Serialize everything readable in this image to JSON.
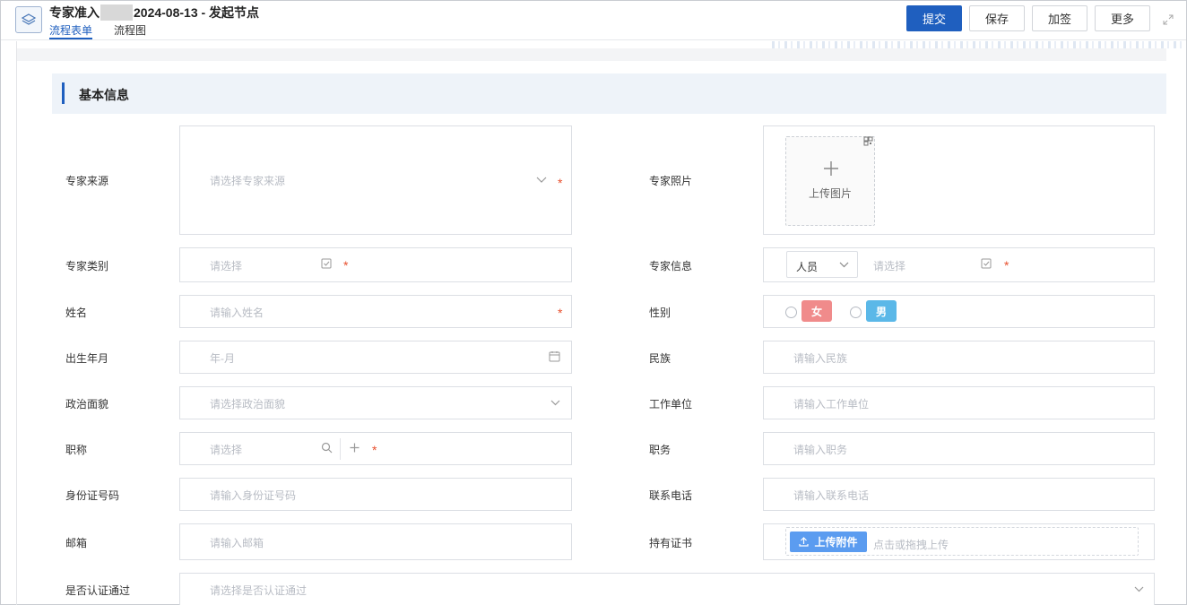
{
  "header": {
    "title_prefix": "专家准入",
    "title_suffix": "2024-08-13 - 发起节点",
    "tabs": [
      {
        "label": "流程表单",
        "active": true
      },
      {
        "label": "流程图",
        "active": false
      }
    ],
    "actions": {
      "submit": "提交",
      "save": "保存",
      "add_sign": "加签",
      "more": "更多"
    }
  },
  "section": {
    "title": "基本信息"
  },
  "form": {
    "expert_source": {
      "label": "专家来源",
      "placeholder": "请选择专家来源"
    },
    "expert_photo": {
      "label": "专家照片",
      "upload_text": "上传图片"
    },
    "expert_category": {
      "label": "专家类别",
      "placeholder": "请选择"
    },
    "expert_info": {
      "label": "专家信息",
      "type_value": "人员",
      "placeholder": "请选择"
    },
    "name": {
      "label": "姓名",
      "placeholder": "请输入姓名"
    },
    "gender": {
      "label": "性别",
      "female": "女",
      "male": "男"
    },
    "birth": {
      "label": "出生年月",
      "placeholder": "年-月"
    },
    "ethnicity": {
      "label": "民族",
      "placeholder": "请输入民族"
    },
    "political": {
      "label": "政治面貌",
      "placeholder": "请选择政治面貌"
    },
    "work_unit": {
      "label": "工作单位",
      "placeholder": "请输入工作单位"
    },
    "title": {
      "label": "职称",
      "placeholder": "请选择"
    },
    "position": {
      "label": "职务",
      "placeholder": "请输入职务"
    },
    "id_number": {
      "label": "身份证号码",
      "placeholder": "请输入身份证号码"
    },
    "phone": {
      "label": "联系电话",
      "placeholder": "请输入联系电话"
    },
    "email": {
      "label": "邮箱",
      "placeholder": "请输入邮箱"
    },
    "certificate": {
      "label": "持有证书",
      "upload_button": "上传附件",
      "hint": "点击或拖拽上传"
    },
    "certified": {
      "label": "是否认证通过",
      "placeholder": "请选择是否认证通过"
    }
  },
  "colors": {
    "primary": "#1f5fbf",
    "required": "#e8502f",
    "female_tag": "#f08b8b",
    "male_tag": "#5bb8e8",
    "upload_button": "#5b9cf0"
  }
}
